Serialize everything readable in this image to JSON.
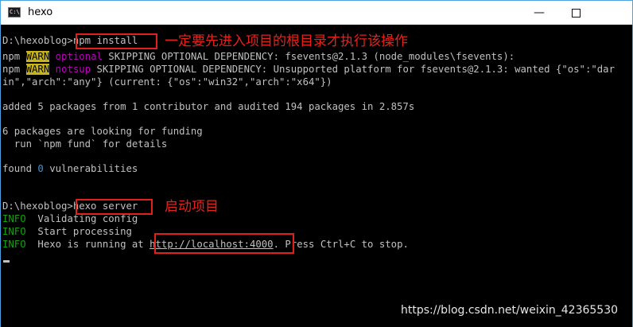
{
  "window": {
    "title": "hexo",
    "icon_glyph": "C:\\",
    "minimize_glyph": "—"
  },
  "terminal": {
    "cmd1": {
      "prompt": "D:\\hexoblog>",
      "command": "npm install"
    },
    "warn1": {
      "prefix": "npm ",
      "level": "WARN",
      "tag": " optional",
      "message": " SKIPPING OPTIONAL DEPENDENCY: fsevents@2.1.3 (node_modules\\fsevents):"
    },
    "warn2": {
      "prefix": "npm ",
      "level": "WARN",
      "tag": " notsup",
      "message": " SKIPPING OPTIONAL DEPENDENCY: Unsupported platform for fsevents@2.1.3: wanted {\"os\":\"dar"
    },
    "warn2_cont": "in\",\"arch\":\"any\"} (current: {\"os\":\"win32\",\"arch\":\"x64\"})",
    "added": "added 5 packages from 1 contributor and audited 194 packages in 2.857s",
    "funding1": "6 packages are looking for funding",
    "funding2": "  run `npm fund` for details",
    "vuln_prefix": "found ",
    "vuln_count": "0",
    "vuln_suffix": " vulnerabilities",
    "cmd2": {
      "prompt": "D:\\hexoblog>",
      "command": "hexo server"
    },
    "info1": {
      "level": "INFO",
      "message": "  Validating config"
    },
    "info2": {
      "level": "INFO",
      "message": "  Start processing"
    },
    "info3": {
      "level": "INFO",
      "message_prefix": "  Hexo is running at ",
      "url": "http://localhost:4000",
      "message_suffix": ". Press Ctrl+C to stop."
    }
  },
  "annotations": {
    "note1": "一定要先进入项目的根目录才执行该操作",
    "note2": "启动项目"
  },
  "watermark": "https://blog.csdn.net/weixin_42365530",
  "colors": {
    "annotation_red": "#e0201a",
    "warn_bg": "#c8b418",
    "info_green": "#13a10e",
    "tag_magenta": "#c000c0"
  }
}
